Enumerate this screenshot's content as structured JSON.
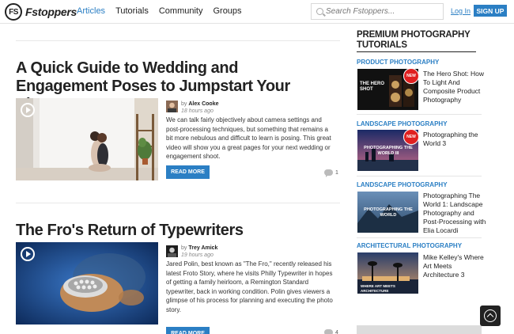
{
  "nav": {
    "logo_badge": "FS",
    "logo_text": "Fstoppers",
    "links": [
      "Articles",
      "Tutorials",
      "Community",
      "Groups"
    ],
    "active_link": "Articles",
    "search_placeholder": "Search Fstoppers...",
    "login_label": "Log In",
    "signup_label": "SIGN UP",
    "accent_color": "#2b7fc4"
  },
  "articles": [
    {
      "title": "A Quick Guide to Wedding and Engagement Poses to Jumpstart Your Photos",
      "author_prefix": "by",
      "author": "Alex Cooke",
      "time": "18 hours ago",
      "excerpt": "We can talk fairly objectively about camera settings and post-processing techniques, but something that remains a bit more nebulous and difficult to learn is posing. This great video will show you a great pages for your next wedding or engagement shoot.",
      "read_more": "READ MORE",
      "comments": "1"
    },
    {
      "title": "The Fro's Return of Typewriters",
      "author_prefix": "by",
      "author": "Trey Amick",
      "time": "19 hours ago",
      "excerpt": "Jared Polin, best known as \"The Fro,\" recently released his latest Froto Story, where he visits Philly Typewriter in hopes of getting a family heirloom, a Remington Standard typewriter, back in working condition. Polin gives viewers a glimpse of his process for planning and executing the photo story.",
      "read_more": "READ MORE",
      "comments": "4"
    }
  ],
  "sidebar": {
    "title": "PREMIUM PHOTOGRAPHY TUTORIALS",
    "items": [
      {
        "category": "PRODUCT PHOTOGRAPHY",
        "text": "The Hero Shot: How To Light And Composite Product Photography",
        "badge": "NEW",
        "thumb_text": "THE HERO SHOT"
      },
      {
        "category": "LANDSCAPE PHOTOGRAPHY",
        "text": "Photographing the World 3",
        "badge": "NEW",
        "thumb_text": "PHOTOGRAPHING THE WORLD III"
      },
      {
        "category": "LANDSCAPE PHOTOGRAPHY",
        "text": "Photographing The World 1: Landscape Photography and Post-Processing with Elia Locardi",
        "badge": "",
        "thumb_text": "PHOTOGRAPHING THE WORLD"
      },
      {
        "category": "ARCHITECTURAL PHOTOGRAPHY",
        "text": "Mike Kelley's Where Art Meets Architecture 3",
        "badge": "",
        "thumb_text": "WHERE ART MEETS ARCHITECTURE"
      }
    ]
  }
}
